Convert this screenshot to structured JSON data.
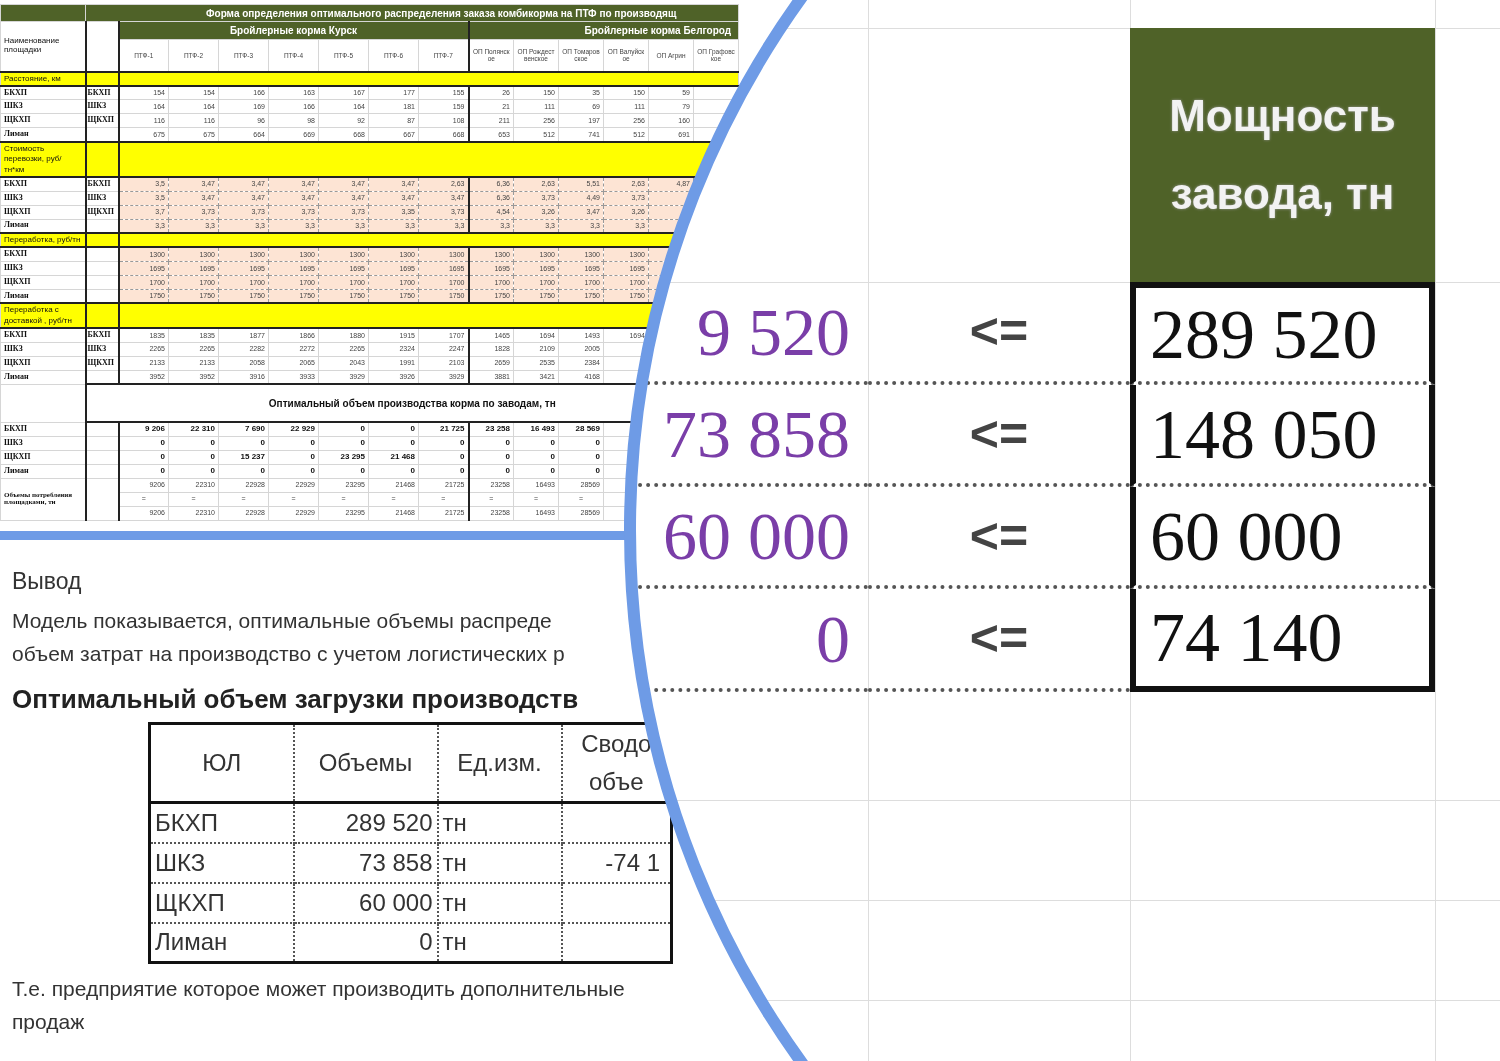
{
  "top_sheet": {
    "title": "Форма определения оптимального распределения заказа комбикорма на ПТФ по производящ",
    "corner_header": "Наименование площадки",
    "groups": [
      {
        "label": "Бройлерные корма Курск",
        "columns": [
          "ПТФ-1",
          "ПТФ-2",
          "ПТФ-3",
          "ПТФ-4",
          "ПТФ-5",
          "ПТФ-6",
          "ПТФ-7"
        ]
      },
      {
        "label": "Бройлерные корма Белгород",
        "columns": [
          "ОП Полянское",
          "ОП Рождественское",
          "ОП Томаровское",
          "ОП Валуйское",
          "ОП Агрин",
          "ОП Графовское"
        ]
      }
    ],
    "sections": [
      {
        "label": "Расстояние, км",
        "shaded": false,
        "rows": [
          {
            "name": "БКХП",
            "code": "БКХП",
            "values": [
              "154",
              "154",
              "166",
              "163",
              "167",
              "177",
              "155",
              "26",
              "150",
              "35",
              "150",
              "59"
            ]
          },
          {
            "name": "ШКЗ",
            "code": "ШКЗ",
            "values": [
              "164",
              "164",
              "169",
              "166",
              "164",
              "181",
              "159",
              "21",
              "111",
              "69",
              "111",
              "79"
            ]
          },
          {
            "name": "ЩКХП",
            "code": "ЩКХП",
            "values": [
              "116",
              "116",
              "96",
              "98",
              "92",
              "87",
              "108",
              "211",
              "256",
              "197",
              "256",
              "160"
            ]
          },
          {
            "name": "Лиман",
            "values": [
              "675",
              "675",
              "664",
              "669",
              "668",
              "667",
              "668",
              "653",
              "512",
              "741",
              "512",
              "691"
            ]
          }
        ]
      },
      {
        "label": "Стоимость перевозки, руб/тн*км",
        "shaded": true,
        "rows": [
          {
            "name": "БКХП",
            "code": "БКХП",
            "values": [
              "3,5",
              "3,47",
              "3,47",
              "3,47",
              "3,47",
              "3,47",
              "2,63",
              "6,36",
              "2,63",
              "5,51",
              "2,63",
              "4,87"
            ]
          },
          {
            "name": "ШКЗ",
            "code": "ШКЗ",
            "values": [
              "3,5",
              "3,47",
              "3,47",
              "3,47",
              "3,47",
              "3,47",
              "3,47",
              "6,36",
              "3,73",
              "4,49",
              "3,73"
            ]
          },
          {
            "name": "ЩКХП",
            "code": "ЩКХП",
            "values": [
              "3,7",
              "3,73",
              "3,73",
              "3,73",
              "3,73",
              "3,35",
              "3,73",
              "4,54",
              "3,26",
              "3,47",
              "3,26"
            ]
          },
          {
            "name": "Лиман",
            "values": [
              "3,3",
              "3,3",
              "3,3",
              "3,3",
              "3,3",
              "3,3",
              "3,3",
              "3,3",
              "3,3",
              "3,3",
              "3,3"
            ]
          }
        ]
      },
      {
        "label": "Переработка, руб/тн",
        "shaded": true,
        "rows": [
          {
            "name": "БКХП",
            "values": [
              "1300",
              "1300",
              "1300",
              "1300",
              "1300",
              "1300",
              "1300",
              "1300",
              "1300",
              "1300",
              "1300"
            ]
          },
          {
            "name": "ШКЗ",
            "values": [
              "1695",
              "1695",
              "1695",
              "1695",
              "1695",
              "1695",
              "1695",
              "1695",
              "1695",
              "1695",
              "1695"
            ]
          },
          {
            "name": "ЩКХП",
            "values": [
              "1700",
              "1700",
              "1700",
              "1700",
              "1700",
              "1700",
              "1700",
              "1700",
              "1700",
              "1700",
              "1700"
            ]
          },
          {
            "name": "Лиман",
            "values": [
              "1750",
              "1750",
              "1750",
              "1750",
              "1750",
              "1750",
              "1750",
              "1750",
              "1750",
              "1750",
              "1750"
            ]
          }
        ]
      },
      {
        "label": "Переработка с доставкой , руб/тн",
        "shaded": false,
        "rows": [
          {
            "name": "БКХП",
            "code": "БКХП",
            "values": [
              "1835",
              "1835",
              "1877",
              "1866",
              "1880",
              "1915",
              "1707",
              "1465",
              "1694",
              "1493",
              "1694"
            ]
          },
          {
            "name": "ШКЗ",
            "code": "ШКЗ",
            "values": [
              "2265",
              "2265",
              "2282",
              "2272",
              "2265",
              "2324",
              "2247",
              "1828",
              "2109",
              "2005"
            ]
          },
          {
            "name": "ЩКХП",
            "code": "ЩКХП",
            "values": [
              "2133",
              "2133",
              "2058",
              "2065",
              "2043",
              "1991",
              "2103",
              "2659",
              "2535",
              "2384"
            ]
          },
          {
            "name": "Лиман",
            "values": [
              "3952",
              "3952",
              "3916",
              "3933",
              "3929",
              "3926",
              "3929",
              "3881",
              "3421",
              "4168"
            ]
          }
        ]
      }
    ],
    "optimal": {
      "heading": "Оптимальный объем производства корма по заводам, тн",
      "rows": [
        {
          "name": "БКХП",
          "values": [
            "9 206",
            "22 310",
            "7 690",
            "22 929",
            "0",
            "0",
            "21 725",
            "23 258",
            "16 493",
            "28 569"
          ]
        },
        {
          "name": "ШКЗ",
          "values": [
            "0",
            "0",
            "0",
            "0",
            "0",
            "0",
            "0",
            "0",
            "0",
            "0"
          ]
        },
        {
          "name": "ЩКХП",
          "values": [
            "0",
            "0",
            "15 237",
            "0",
            "23 295",
            "21 468",
            "0",
            "0",
            "0",
            "0"
          ]
        },
        {
          "name": "Лиман",
          "values": [
            "0",
            "0",
            "0",
            "0",
            "0",
            "0",
            "0",
            "0",
            "0",
            "0"
          ]
        }
      ]
    },
    "consumption": {
      "label": "Объемы потребления площадками, тн",
      "computed": [
        "9206",
        "22310",
        "22928",
        "22929",
        "23295",
        "21468",
        "21725",
        "23258",
        "16493",
        "28569"
      ],
      "signs": [
        "=",
        "=",
        "=",
        "=",
        "=",
        "=",
        "=",
        "=",
        "=",
        "="
      ],
      "limits": [
        "9206",
        "22310",
        "22928",
        "22929",
        "23295",
        "21468",
        "21725",
        "23258",
        "16493",
        "28569"
      ]
    }
  },
  "conclusion": {
    "heading": "Вывод",
    "lines": [
      "Модель показывается, оптимальные объемы распреде",
      "объем затрат на производство с учетом логистических р"
    ]
  },
  "load_table": {
    "heading": "Оптимальный объем загрузки производств",
    "columns": [
      "ЮЛ",
      "Объемы",
      "Ед.изм.",
      "Сводо объе"
    ],
    "rows": [
      {
        "entity": "БКХП",
        "volume": "289 520",
        "unit": "тн"
      },
      {
        "entity": "ШКЗ",
        "volume": "73 858",
        "unit": "тн",
        "summary": "-74 1"
      },
      {
        "entity": "ЩКХП",
        "volume": "60 000",
        "unit": "тн"
      },
      {
        "entity": "Лиман",
        "volume": "0",
        "unit": "тн"
      }
    ]
  },
  "note_lines": [
    "Т.е. предприятие которое может производить дополнительные",
    "продаж"
  ],
  "lens": {
    "header": "Мощность завода, тн",
    "rows": [
      {
        "supply": "9 520",
        "relation": "<=",
        "capacity": "289 520"
      },
      {
        "supply": "73 858",
        "relation": "<=",
        "capacity": "148 050"
      },
      {
        "supply": "60 000",
        "relation": "<=",
        "capacity": "60 000"
      },
      {
        "supply": "0",
        "relation": "<=",
        "capacity": "74 140"
      }
    ]
  }
}
